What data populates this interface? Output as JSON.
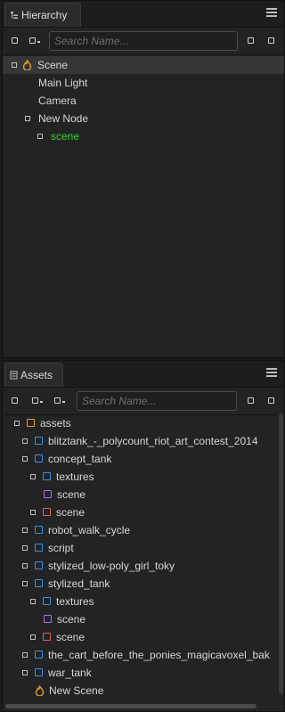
{
  "hierarchy": {
    "tab_label": "Hierarchy",
    "search_placeholder": "Search Name...",
    "rows": [
      {
        "label": "Scene"
      },
      {
        "label": "Main Light"
      },
      {
        "label": "Camera"
      },
      {
        "label": "New Node"
      },
      {
        "label": "scene"
      }
    ]
  },
  "assets": {
    "tab_label": "Assets",
    "search_placeholder": "Search Name...",
    "rows": [
      {
        "label": "assets"
      },
      {
        "label": "blitztank_-_polycount_riot_art_contest_2014"
      },
      {
        "label": "concept_tank"
      },
      {
        "label": "textures"
      },
      {
        "label": "scene"
      },
      {
        "label": "scene"
      },
      {
        "label": "robot_walk_cycle"
      },
      {
        "label": "script"
      },
      {
        "label": "stylized_low-poly_girl_toky"
      },
      {
        "label": "stylized_tank"
      },
      {
        "label": "textures"
      },
      {
        "label": "scene"
      },
      {
        "label": "scene"
      },
      {
        "label": "the_cart_before_the_ponies_magicavoxel_bak"
      },
      {
        "label": "war_tank"
      },
      {
        "label": "New Scene"
      }
    ]
  },
  "colors": {
    "accent_green": "#35d335",
    "folder_blue": "#3a8ee6",
    "scene_purple": "#b06be6",
    "scene_red": "#e06060",
    "scene_orange": "#e0a02a"
  }
}
